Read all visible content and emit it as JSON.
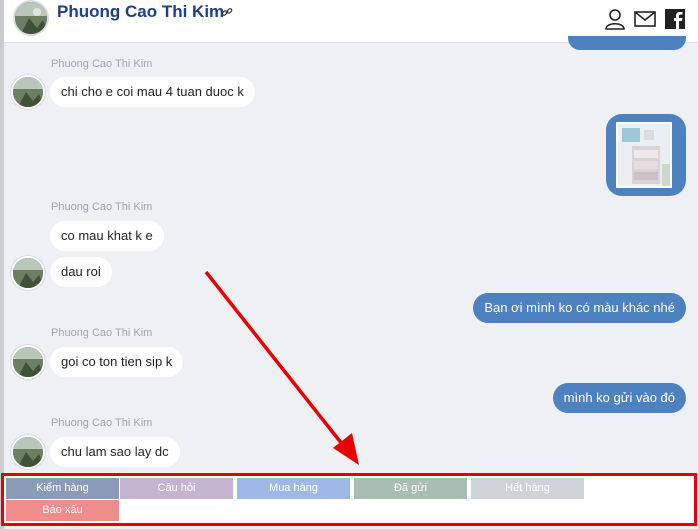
{
  "header": {
    "name": "Phuong Cao Thi Kim",
    "icons": [
      "user-icon",
      "mail-icon",
      "facebook-icon"
    ]
  },
  "messages": [
    {
      "type": "incoming",
      "sender": "Phuong Cao Thi Kim",
      "text": "chi cho e coi mau 4 tuan duoc k"
    },
    {
      "type": "outgoing-image"
    },
    {
      "type": "incoming",
      "sender": "Phuong Cao Thi Kim",
      "text": "co mau khat k e"
    },
    {
      "type": "incoming",
      "text": "dau roi"
    },
    {
      "type": "outgoing",
      "text": "Bạn ơi mình ko có màu khác nhé"
    },
    {
      "type": "incoming",
      "sender": "Phuong Cao Thi Kim",
      "text": "goi co ton tien sip k"
    },
    {
      "type": "outgoing",
      "text": "mình ko gửi vào đó"
    },
    {
      "type": "incoming",
      "sender": "Phuong Cao Thi Kim",
      "text": "chu lam sao lay dc"
    }
  ],
  "quick_buttons": [
    {
      "label": "Kiểm hàng",
      "color": "#8a9bb8"
    },
    {
      "label": "Câu hỏi",
      "color": "#c4b4cf"
    },
    {
      "label": "Mua hàng",
      "color": "#9fb8e6"
    },
    {
      "label": "Đã gửi",
      "color": "#a9bdb0"
    },
    {
      "label": "Hết hàng",
      "color": "#ced3d8"
    },
    {
      "label": "Báo xấu",
      "color": "#f08c8c"
    }
  ],
  "colors": {
    "accent": "#4e81c0",
    "annotation": "#e60000"
  }
}
